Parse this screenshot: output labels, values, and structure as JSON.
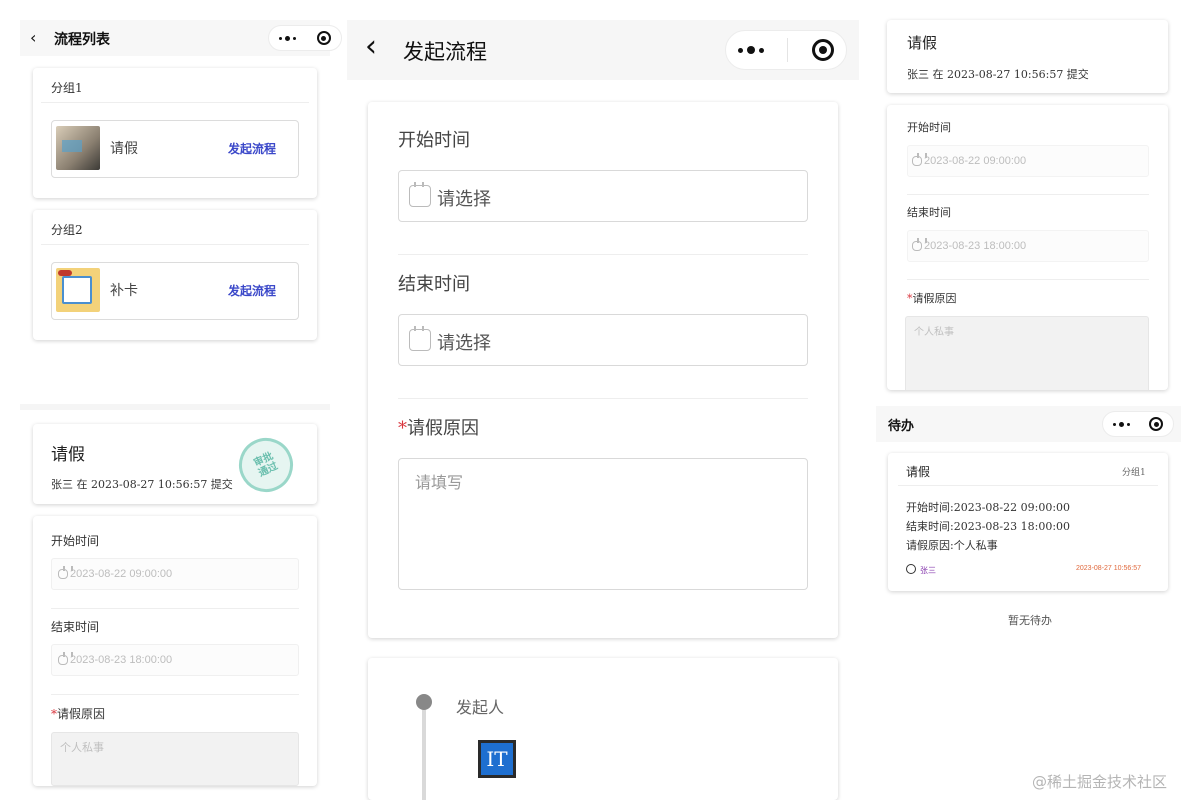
{
  "panel_list": {
    "title": "流程列表",
    "groups": [
      {
        "name": "分组1",
        "item_name": "请假",
        "action": "发起流程"
      },
      {
        "name": "分组2",
        "item_name": "补卡",
        "action": "发起流程"
      }
    ]
  },
  "panel_detail_left": {
    "title": "请假",
    "submitter": "张三 在 2023-08-27 10:56:57 提交",
    "stamp_text": "审批通过",
    "fields": [
      {
        "label": "开始时间",
        "value": "2023-08-22 09:00:00"
      },
      {
        "label": "结束时间",
        "value": "2023-08-23 18:00:00"
      }
    ],
    "reason_label": "请假原因",
    "reason_value": "个人私事"
  },
  "panel_start": {
    "title": "发起流程",
    "start_label": "开始时间",
    "start_placeholder": "请选择",
    "end_label": "结束时间",
    "end_placeholder": "请选择",
    "reason_label": "请假原因",
    "reason_placeholder": "请填写",
    "timeline_label": "发起人",
    "avatar_text": "IT"
  },
  "panel_detail_right": {
    "title": "请假",
    "submitter": "张三 在 2023-08-27 10:56:57 提交",
    "fields": [
      {
        "label": "开始时间",
        "value": "2023-08-22 09:00:00"
      },
      {
        "label": "结束时间",
        "value": "2023-08-23 18:00:00"
      }
    ],
    "reason_label": "请假原因",
    "reason_value": "个人私事"
  },
  "panel_todo": {
    "title": "待办",
    "card_title": "请假",
    "card_group": "分组1",
    "lines": [
      "开始时间:2023-08-22 09:00:00",
      "结束时间:2023-08-23 18:00:00",
      "请假原因:个人私事"
    ],
    "user": "张三",
    "time": "2023-08-27 10:56:57",
    "empty_text": "暂无待办"
  },
  "watermark": "@稀土掘金技术社区",
  "required_mark": "*",
  "colors": {
    "link": "#3b48c9",
    "required": "#d9363e",
    "time": "#e0683c",
    "user": "#8a3fb0"
  }
}
